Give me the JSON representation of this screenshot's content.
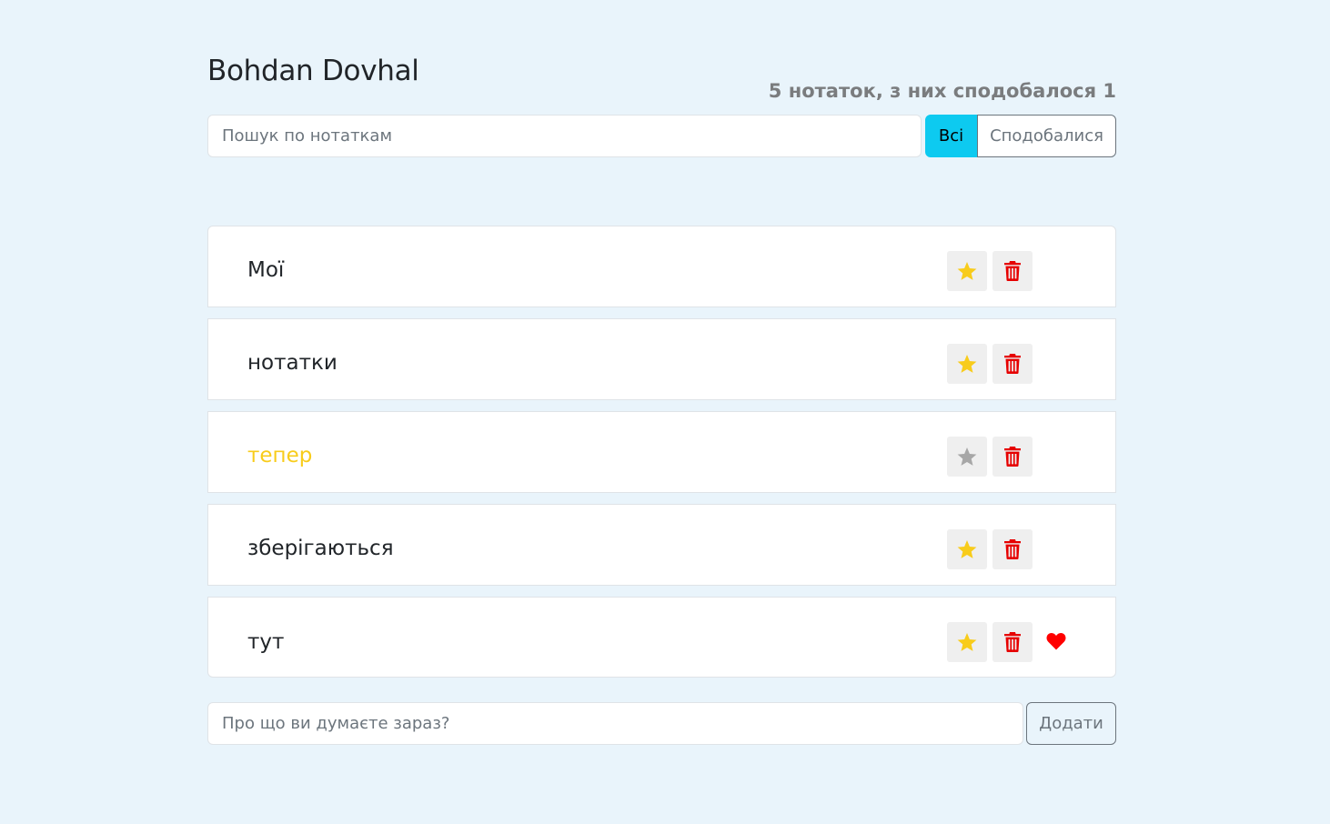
{
  "header": {
    "title": "Bohdan Dovhal",
    "stats": "5 нотаток, з них сподобалося 1"
  },
  "search": {
    "placeholder": "Пошук по нотаткам",
    "value": ""
  },
  "filters": {
    "all_label": "Всі",
    "liked_label": "Сподобалися",
    "active": "all"
  },
  "notes": [
    {
      "label": "Мої",
      "important": false,
      "liked": false
    },
    {
      "label": "нотатки",
      "important": false,
      "liked": false
    },
    {
      "label": "тепер",
      "important": true,
      "liked": false
    },
    {
      "label": "зберігаються",
      "important": false,
      "liked": false
    },
    {
      "label": "тут",
      "important": false,
      "liked": true
    }
  ],
  "add_form": {
    "placeholder": "Про що ви думаєте зараз?",
    "value": "",
    "button_label": "Додати"
  },
  "icons": {
    "star": "star-icon",
    "trash": "trash-icon",
    "heart": "heart-icon"
  },
  "colors": {
    "background": "#e9f4fb",
    "star_active": "#f8cc1b",
    "star_inactive": "#a7a7a7",
    "trash": "#e60000",
    "heart": "#ff0000",
    "important_text": "#f8cc1b",
    "filter_active": "#0dcaf0"
  }
}
